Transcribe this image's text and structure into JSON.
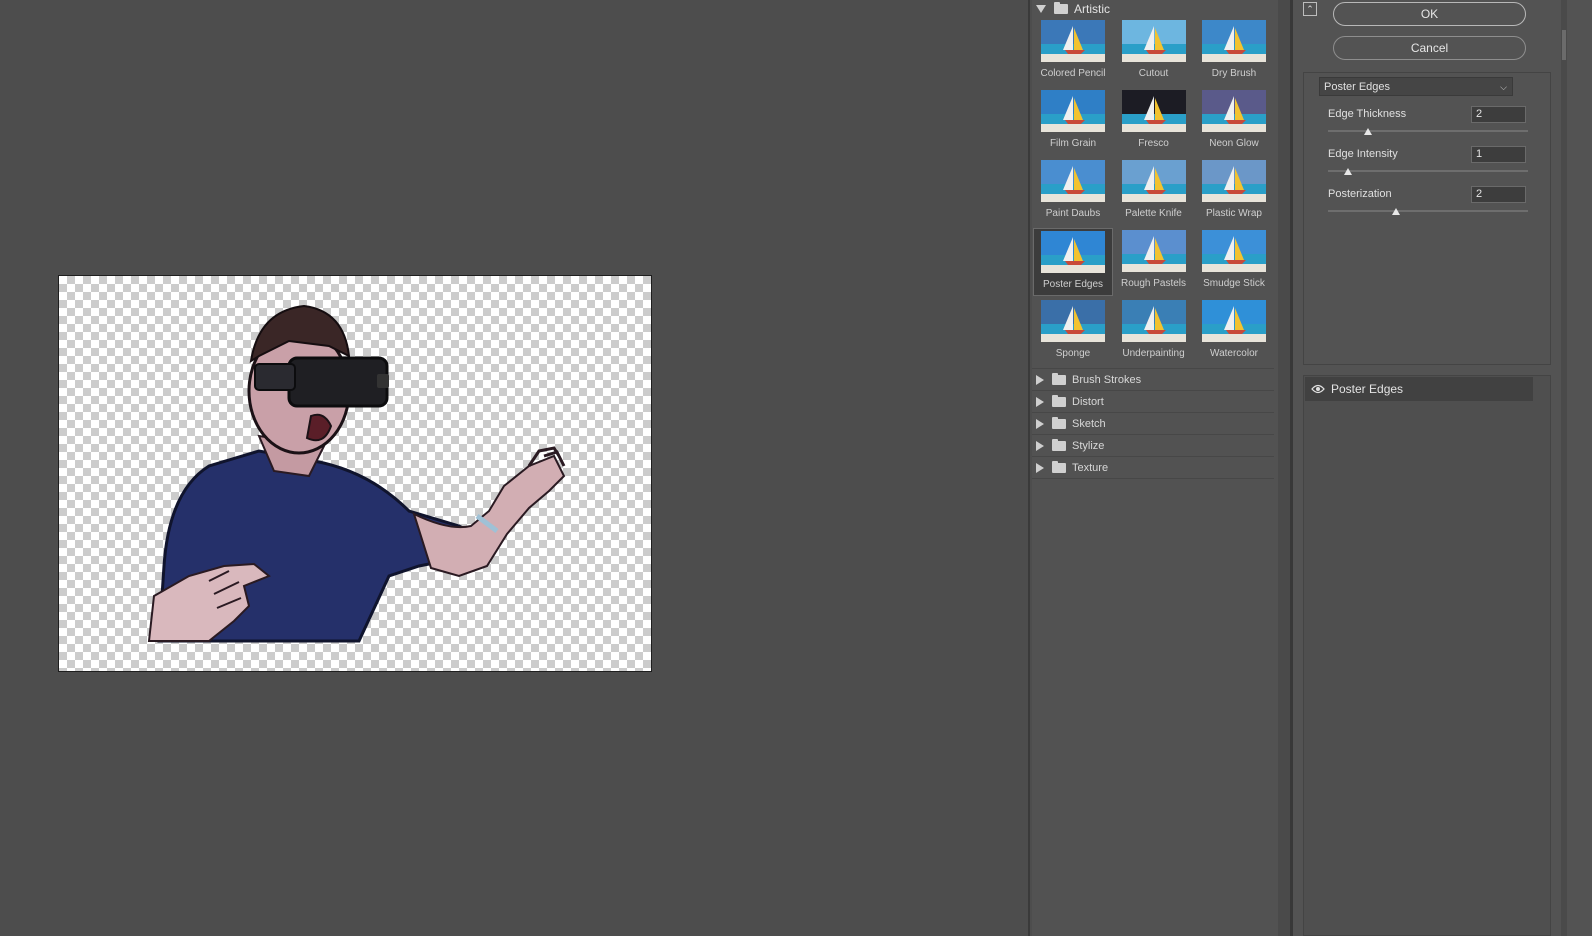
{
  "gallery": {
    "expanded_category": "Artistic",
    "filters": [
      {
        "label": "Colored Pencil",
        "selected": false
      },
      {
        "label": "Cutout",
        "selected": false
      },
      {
        "label": "Dry Brush",
        "selected": false
      },
      {
        "label": "Film Grain",
        "selected": false
      },
      {
        "label": "Fresco",
        "selected": false
      },
      {
        "label": "Neon Glow",
        "selected": false
      },
      {
        "label": "Paint Daubs",
        "selected": false
      },
      {
        "label": "Palette Knife",
        "selected": false
      },
      {
        "label": "Plastic Wrap",
        "selected": false
      },
      {
        "label": "Poster Edges",
        "selected": true
      },
      {
        "label": "Rough Pastels",
        "selected": false
      },
      {
        "label": "Smudge Stick",
        "selected": false
      },
      {
        "label": "Sponge",
        "selected": false
      },
      {
        "label": "Underpainting",
        "selected": false
      },
      {
        "label": "Watercolor",
        "selected": false
      }
    ],
    "collapsed_categories": [
      "Brush Strokes",
      "Distort",
      "Sketch",
      "Stylize",
      "Texture"
    ]
  },
  "settings": {
    "ok_label": "OK",
    "cancel_label": "Cancel",
    "filter_select_value": "Poster Edges",
    "params": [
      {
        "label": "Edge Thickness",
        "value": "2",
        "slider_fraction": 0.2
      },
      {
        "label": "Edge Intensity",
        "value": "1",
        "slider_fraction": 0.1
      },
      {
        "label": "Posterization",
        "value": "2",
        "slider_fraction": 0.34
      }
    ],
    "effect_layer": "Poster Edges"
  },
  "colors": {
    "app_background": "#4d4d4d",
    "panel_background": "#535353",
    "selected_cell": "#3c3c3c"
  },
  "icons": {
    "collapse": "collapse-up-icon",
    "visibility": "eye-icon",
    "folder": "folder-icon"
  }
}
